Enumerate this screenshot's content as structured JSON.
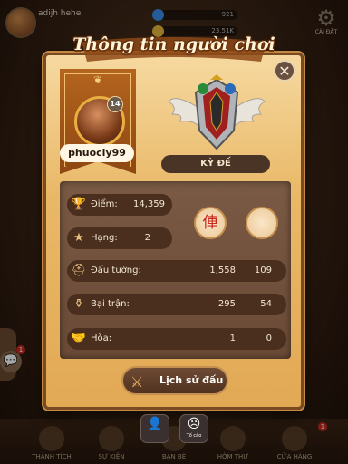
{
  "header": {
    "username": "adijh hehe",
    "resource_1": "921",
    "resource_2": "23.51K",
    "settings_label": "CÀI ĐẶT"
  },
  "modal": {
    "title": "Thông tin người chơi",
    "close_symbol": "✕",
    "player_name": "phuocly99",
    "level": "14",
    "rank_title": "KỲ ĐẾ",
    "stats": {
      "score_label": "Điểm:",
      "score_value": "14,359",
      "rank_label": "Hạng:",
      "rank_value": "2",
      "games_label": "Đấu tướng:",
      "games_total": "1,558",
      "games_second": "109",
      "losses_label": "Bại trận:",
      "losses_total": "295",
      "losses_second": "54",
      "draws_label": "Hòa:",
      "draws_total": "1",
      "draws_second": "0"
    },
    "piece_red_char": "俥",
    "history_button": "Lịch sử đấu"
  },
  "actions": {
    "add_friend_icon": "person-plus-icon",
    "report_label": "Tố cáo"
  },
  "bottom_nav": {
    "items": [
      "THÀNH TÍCH",
      "SỰ KIỆN",
      "BẠN BÈ",
      "HÒM THƯ",
      "CỬA HÀNG"
    ]
  },
  "notifications": {
    "chat_badge": "1",
    "shop_badge": "1"
  },
  "colors": {
    "modal_bg": "#e9b867",
    "panel_bg": "#6a4a36",
    "pill_bg": "#4a2e1e",
    "accent_red": "#c8281e"
  }
}
